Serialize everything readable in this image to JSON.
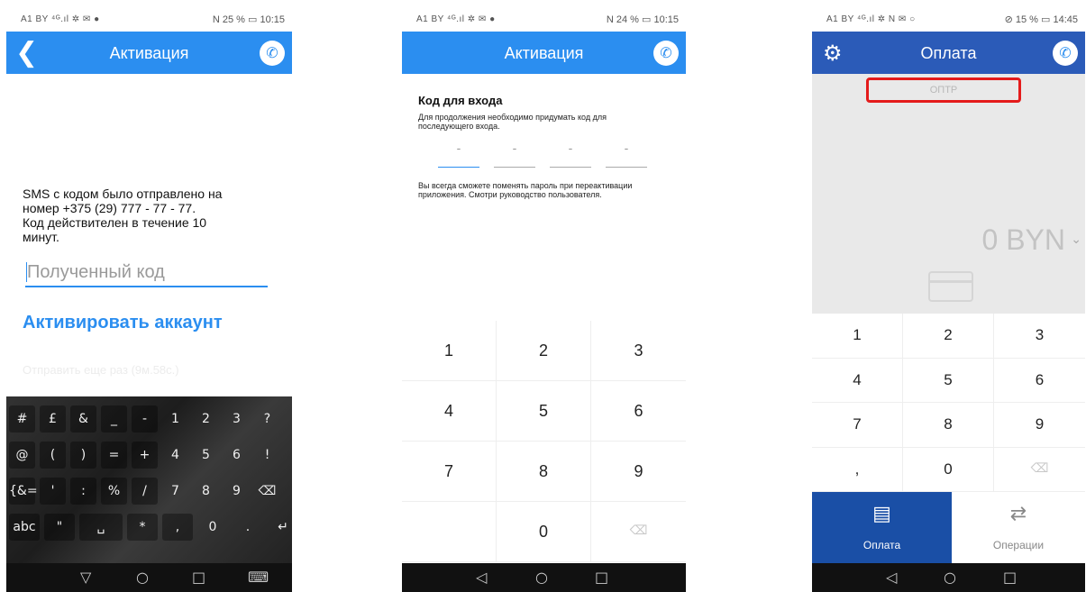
{
  "screen1": {
    "status_left": "A1 BY ⁴ᴳ.ıl ✲ ✉ ●",
    "status_right": "N 25 % ▭ 10:15",
    "title": "Активация",
    "sms_text": "SMS с кодом было отправлено на\nномер +375 (29) 777 - 77 - 77.\nКод действителен в течение 10\nминут.",
    "code_placeholder": "Полученный код",
    "activate_label": "Активировать аккаунт",
    "resend_label": "Отправить еще раз (9м.58с.)",
    "keyboard_rows": [
      [
        "#",
        "£",
        "&",
        "_",
        "-",
        "1",
        "2",
        "3",
        "?"
      ],
      [
        "@",
        "(",
        ")",
        "=",
        "+",
        "4",
        "5",
        "6",
        "!"
      ],
      [
        "{&=",
        "'",
        ":",
        "%",
        "/",
        "7",
        "8",
        "9",
        "⌫"
      ],
      [
        "abc",
        "\"",
        "␣",
        "*",
        ",",
        "0",
        ".",
        "↵"
      ]
    ]
  },
  "screen2": {
    "status_left": "A1 BY ⁴ᴳ.ıl ✲ ✉ ●",
    "status_right": "N 24 % ▭ 10:15",
    "title": "Активация",
    "heading": "Код для входа",
    "description": "Для продолжения необходимо придумать код для последующего входа.",
    "pin_placeholder": "-",
    "note": "Вы всегда сможете поменять пароль при переактивации приложения. Смотри руководство пользователя.",
    "keys": [
      "1",
      "2",
      "3",
      "4",
      "5",
      "6",
      "7",
      "8",
      "9",
      "",
      "0",
      "⌫"
    ]
  },
  "screen3": {
    "status_left": "A1 BY ⁴ᴳ.ıl ✲ N ✉ ○",
    "status_right": "⊘ 15 % ▭ 14:45",
    "title": "Оплата",
    "merchant_label": "ОПТР",
    "amount": "0 BYN",
    "keys": [
      "1",
      "2",
      "3",
      "4",
      "5",
      "6",
      "7",
      "8",
      "9",
      ",",
      "0",
      "⌫"
    ],
    "tabs": [
      {
        "label": "Оплата",
        "active": true
      },
      {
        "label": "Операции",
        "active": false
      }
    ]
  },
  "colors": {
    "accent": "#2b8ef0",
    "highlight_box": "#e41b1b",
    "active_tab": "#1a4fa6"
  },
  "icons": [
    "back-chevron-icon",
    "phone-call-icon",
    "gear-icon",
    "card-icon",
    "receipt-icon",
    "transfer-arrows-icon",
    "backspace-icon",
    "nav-back-icon",
    "nav-home-icon",
    "nav-recent-icon",
    "keyboard-icon"
  ]
}
